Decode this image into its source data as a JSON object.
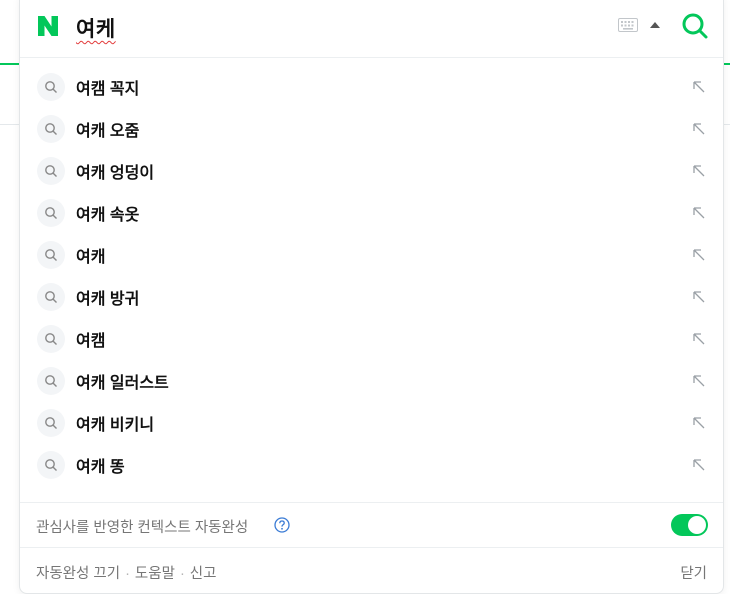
{
  "search": {
    "query": "여케",
    "logo_letter": "N"
  },
  "suggestions": [
    {
      "label": "여캠 꼭지"
    },
    {
      "label": "여캐 오줌"
    },
    {
      "label": "여캐 엉덩이"
    },
    {
      "label": "여캐 속옷"
    },
    {
      "label": "여캐"
    },
    {
      "label": "여캐 방귀"
    },
    {
      "label": "여캠"
    },
    {
      "label": "여캐 일러스트"
    },
    {
      "label": "여캐 비키니"
    },
    {
      "label": "여캐 똥"
    }
  ],
  "context": {
    "text": "관심사를 반영한 컨텍스트 자동완성",
    "toggle_on": true
  },
  "footer": {
    "autocomplete_off": "자동완성 끄기",
    "help": "도움말",
    "report": "신고",
    "close": "닫기"
  },
  "colors": {
    "brand": "#03c75a",
    "text_muted": "#767676"
  },
  "icons": [
    "naver-logo-icon",
    "keyboard-icon",
    "caret-up-icon",
    "search-icon",
    "suggestion-search-icon",
    "arrow-up-left-icon",
    "help-icon"
  ]
}
